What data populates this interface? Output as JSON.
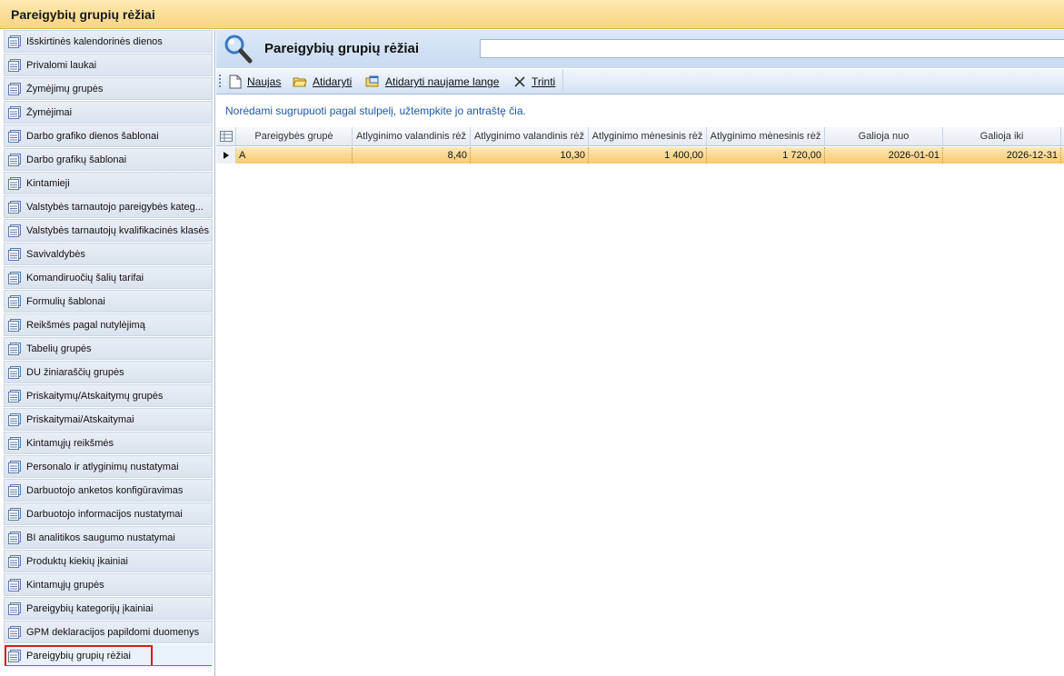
{
  "window": {
    "title": "Pareigybių grupių rėžiai"
  },
  "sidebar": {
    "items": [
      {
        "label": "Išskirtinės kalendorinės dienos"
      },
      {
        "label": "Privalomi laukai"
      },
      {
        "label": "Žymėjimų grupės"
      },
      {
        "label": "Žymėjimai"
      },
      {
        "label": "Darbo grafiko dienos šablonai"
      },
      {
        "label": "Darbo grafikų šablonai"
      },
      {
        "label": "Kintamieji"
      },
      {
        "label": "Valstybės tarnautojo pareigybės kateg..."
      },
      {
        "label": "Valstybės tarnautojų kvalifikacinės klasės"
      },
      {
        "label": "Savivaldybės"
      },
      {
        "label": "Komandiruočių šalių tarifai"
      },
      {
        "label": "Formulių šablonai"
      },
      {
        "label": "Reikšmės pagal nutylėjimą"
      },
      {
        "label": "Tabelių grupės"
      },
      {
        "label": "DU žiniaraščių grupės"
      },
      {
        "label": "Priskaitymų/Atskaitymų grupės"
      },
      {
        "label": "Priskaitymai/Atskaitymai"
      },
      {
        "label": "Kintamųjų reikšmės"
      },
      {
        "label": "Personalo ir atlyginimų nustatymai"
      },
      {
        "label": "Darbuotojo anketos konfigūravimas"
      },
      {
        "label": "Darbuotojo informacijos nustatymai"
      },
      {
        "label": "BI analitikos saugumo nustatymai"
      },
      {
        "label": "Produktų kiekių įkainiai"
      },
      {
        "label": "Kintamųjų grupės"
      },
      {
        "label": "Pareigybių kategorijų įkainiai"
      },
      {
        "label": "GPM deklaracijos papildomi duomenys"
      },
      {
        "label": "Pareigybių grupių rėžiai",
        "selected": true
      }
    ]
  },
  "header": {
    "title": "Pareigybių grupių rėžiai",
    "search_value": ""
  },
  "toolbar": {
    "new_label": "Naujas",
    "open_label": "Atidaryti",
    "open_new_window_label": "Atidaryti naujame lange",
    "delete_label": "Trinti"
  },
  "grid": {
    "group_hint": "Norėdami sugrupuoti pagal stulpelį, užtempkite jo antraštę čia.",
    "columns": [
      "Pareigybės grupė",
      "Atlyginimo valandinis rėž",
      "Atlyginimo valandinis rėž",
      "Atlyginimo mėnesinis rėž",
      "Atlyginimo mėnesinis rėž",
      "Galioja nuo",
      "Galioja iki"
    ],
    "rows": [
      {
        "group": "A",
        "hourly_from": "8,40",
        "hourly_to": "10,30",
        "monthly_from": "1 400,00",
        "monthly_to": "1 720,00",
        "valid_from": "2026-01-01",
        "valid_to": "2026-12-31"
      }
    ]
  }
}
